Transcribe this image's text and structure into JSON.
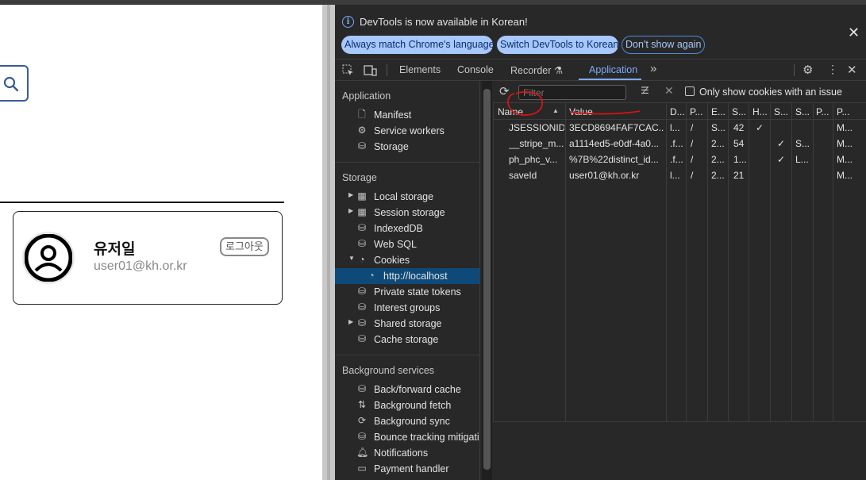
{
  "page": {
    "search_button_icon": "search-icon",
    "profile": {
      "name": "유저일",
      "email": "user01@kh.or.kr",
      "logout_label": "로그아웃",
      "avatar_icon": "user-avatar-icon"
    }
  },
  "devtools": {
    "infobar": {
      "message": "DevTools is now available in Korean!",
      "btn_match": "Always match Chrome's language",
      "btn_switch": "Switch DevTools to Korean",
      "btn_dismiss": "Don't show again"
    },
    "tabs": {
      "elements": "Elements",
      "console": "Console",
      "recorder": "Recorder",
      "application": "Application",
      "more": "»"
    },
    "sidebar": {
      "application_head": "Application",
      "application_items": [
        "Manifest",
        "Service workers",
        "Storage"
      ],
      "storage_head": "Storage",
      "storage_items": [
        "Local storage",
        "Session storage",
        "IndexedDB",
        "Web SQL",
        "Cookies",
        "http://localhost",
        "Private state tokens",
        "Interest groups",
        "Shared storage",
        "Cache storage"
      ],
      "background_head": "Background services",
      "background_items": [
        "Back/forward cache",
        "Background fetch",
        "Background sync",
        "Bounce tracking mitigati",
        "Notifications",
        "Payment handler"
      ]
    },
    "toolbar": {
      "filter_placeholder": "Filter",
      "only_issue_label": "Only show cookies with an issue"
    },
    "table": {
      "headers": [
        "Name",
        "Value",
        "D...",
        "P...",
        "E...",
        "S...",
        "H...",
        "S...",
        "S...",
        "P...",
        "P..."
      ],
      "rows": [
        [
          "JSESSIONID",
          "3ECD8694FAF7CAC...",
          "l...",
          "/",
          "S...",
          "42",
          "✓",
          "",
          "",
          "",
          "M..."
        ],
        [
          "__stripe_m...",
          "a1114ed5-e0df-4a0...",
          ".f...",
          "/",
          "2...",
          "54",
          "",
          "✓",
          "S...",
          "",
          "M..."
        ],
        [
          "ph_phc_v...",
          "%7B%22distinct_id...",
          ".f...",
          "/",
          "2...",
          "1...",
          "",
          "✓",
          "L...",
          "",
          "M..."
        ],
        [
          "saveId",
          "user01@kh.or.kr",
          "l...",
          "/",
          "2...",
          "21",
          "",
          "",
          "",
          "",
          "M..."
        ]
      ]
    }
  }
}
